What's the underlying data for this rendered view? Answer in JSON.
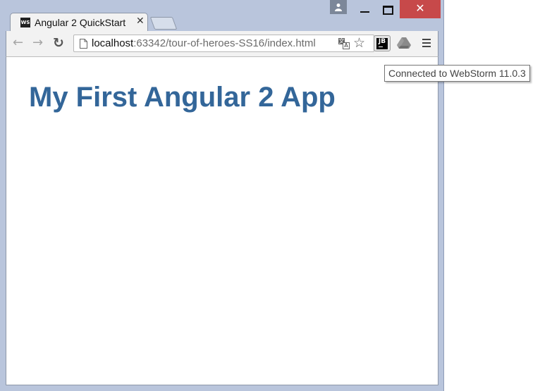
{
  "tab": {
    "favicon_text": "WS",
    "title": "Angular 2 QuickStart",
    "close_glyph": "✕"
  },
  "window_controls": {
    "close_glyph": "✕"
  },
  "toolbar": {
    "url_host": "localhost",
    "url_rest": ":63342/tour-of-heroes-SS16/index.html",
    "translate_a": "文",
    "translate_b": "A",
    "jb_label": "JB"
  },
  "page": {
    "heading": "My First Angular 2 App"
  },
  "tooltip": {
    "text": "Connected to WebStorm 11.0.3"
  },
  "colors": {
    "frame": "#b9c5dc",
    "heading": "#336699",
    "close_button": "#c7494a"
  },
  "icons": [
    "webstorm-favicon-icon",
    "tab-close-icon",
    "profile-icon",
    "minimize-icon",
    "maximize-icon",
    "window-close-icon",
    "back-arrow-icon",
    "forward-arrow-icon",
    "reload-icon",
    "page-icon",
    "translate-icon",
    "star-icon",
    "jetbrains-extension-icon",
    "google-drive-icon",
    "menu-icon"
  ]
}
